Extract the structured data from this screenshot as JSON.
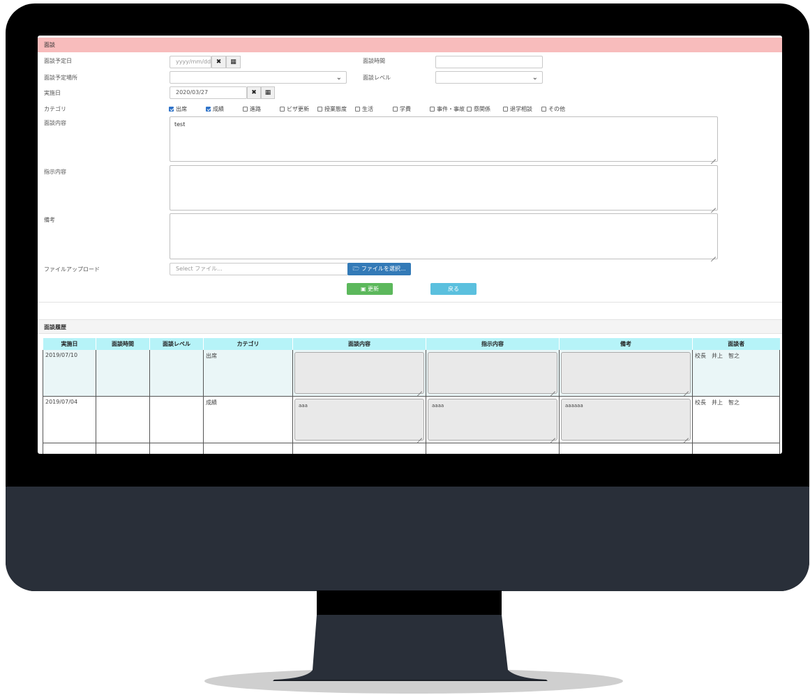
{
  "colors": {
    "header_pink": "#f8bcbc",
    "table_head": "#b6f3f8",
    "update_green": "#5cb85c",
    "back_cyan": "#5bc0de",
    "file_blue": "#337ab7"
  },
  "form": {
    "section_title": "面談",
    "scheduled_date": {
      "label": "面談予定日",
      "placeholder": "yyyy/mm/dd",
      "clear_icon": "times-icon",
      "calendar_icon": "calendar-icon"
    },
    "interview_time": {
      "label": "面談時間",
      "value": ""
    },
    "scheduled_place": {
      "label": "面談予定場所",
      "value": ""
    },
    "interview_level": {
      "label": "面談レベル",
      "value": ""
    },
    "actual_date": {
      "label": "実施日",
      "value": "2020/03/27"
    },
    "category": {
      "label": "カテゴリ",
      "options": [
        {
          "label": "出席",
          "checked": true
        },
        {
          "label": "成績",
          "checked": true
        },
        {
          "label": "進路",
          "checked": false
        },
        {
          "label": "ビザ更新",
          "checked": false
        },
        {
          "label": "授業態度",
          "checked": false
        },
        {
          "label": "生活",
          "checked": false
        },
        {
          "label": "学費",
          "checked": false
        },
        {
          "label": "事件・事故",
          "checked": false
        },
        {
          "label": "祭関係",
          "checked": false
        },
        {
          "label": "退学相談",
          "checked": false
        },
        {
          "label": "その他",
          "checked": false
        }
      ]
    },
    "content": {
      "label": "面談内容",
      "value": "test"
    },
    "instruction": {
      "label": "指示内容",
      "value": ""
    },
    "remarks": {
      "label": "備考",
      "value": ""
    },
    "file_upload": {
      "label": "ファイルアップロード",
      "placeholder": "Select ファイル...",
      "button": "ファイルを選択..."
    },
    "update_button": "更新",
    "back_button": "戻る"
  },
  "history": {
    "title": "面談履歴",
    "columns": [
      "実施日",
      "面談時間",
      "面談レベル",
      "カテゴリ",
      "面談内容",
      "指示内容",
      "備考",
      "面談者"
    ],
    "rows": [
      {
        "date": "2019/07/10",
        "time": "",
        "level": "",
        "category": "出席",
        "content": "",
        "instruction": "",
        "remarks": "",
        "interviewer": "校長　井上　智之"
      },
      {
        "date": "2019/07/04",
        "time": "",
        "level": "",
        "category": "成績",
        "content": "aaa",
        "instruction": "aaaa",
        "remarks": "aaaaaa",
        "interviewer": "校長　井上　智之"
      }
    ]
  }
}
